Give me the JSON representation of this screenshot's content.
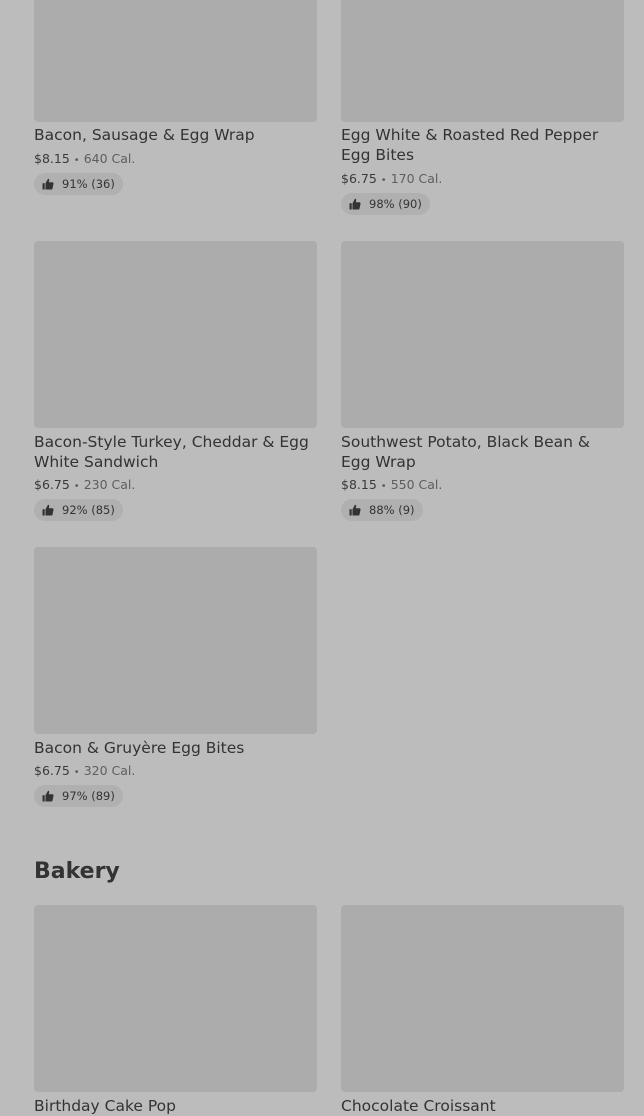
{
  "items": [
    {
      "name": "Bacon, Sausage & Egg Wrap",
      "price": "$8.15",
      "separator": "•",
      "calories": "640 Cal.",
      "rating": "91% (36)"
    },
    {
      "name": "Egg White & Roasted Red Pepper Egg Bites",
      "price": "$6.75",
      "separator": "•",
      "calories": "170 Cal.",
      "rating": "98% (90)"
    },
    {
      "name": "Bacon-Style Turkey, Cheddar & Egg White Sandwich",
      "price": "$6.75",
      "separator": "•",
      "calories": "230 Cal.",
      "rating": "92% (85)"
    },
    {
      "name": "Southwest Potato, Black Bean & Egg Wrap",
      "price": "$8.15",
      "separator": "•",
      "calories": "550 Cal.",
      "rating": "88% (9)"
    },
    {
      "name": "Bacon & Gruyère Egg Bites",
      "price": "$6.75",
      "separator": "•",
      "calories": "320 Cal.",
      "rating": "97% (89)"
    }
  ],
  "bakery": {
    "title": "Bakery",
    "items": [
      {
        "name": "Birthday Cake Pop"
      },
      {
        "name": "Chocolate Croissant"
      }
    ]
  }
}
